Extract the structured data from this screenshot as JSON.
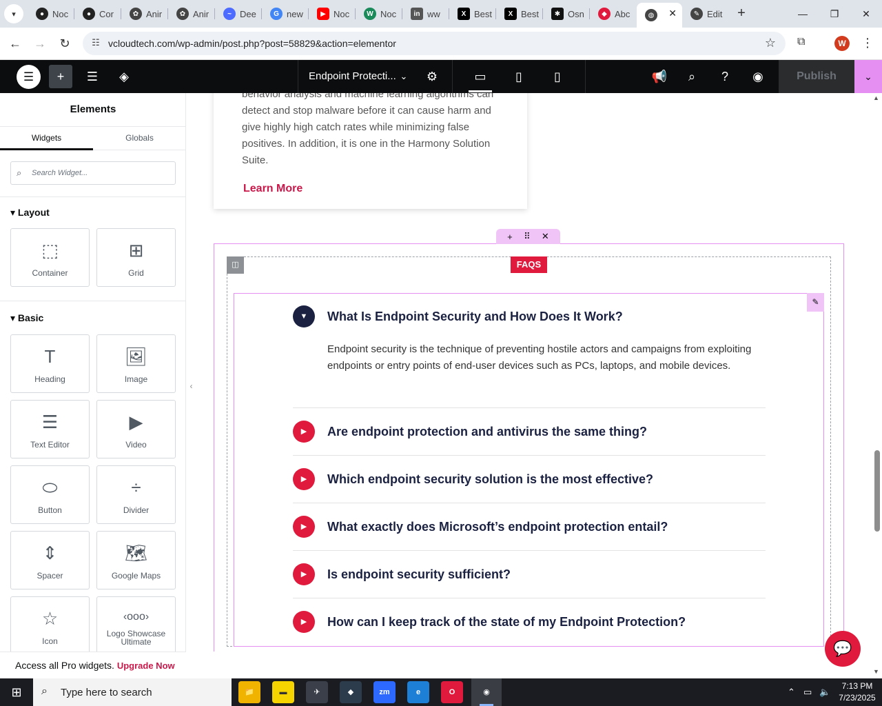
{
  "browser": {
    "tabs": [
      {
        "label": "Noc",
        "icon": "github-icon",
        "color": "#222222"
      },
      {
        "label": "Cor",
        "icon": "github-icon",
        "color": "#222222"
      },
      {
        "label": "Anir",
        "icon": "openai-icon",
        "color": "#444444"
      },
      {
        "label": "Anir",
        "icon": "openai-icon",
        "color": "#444444"
      },
      {
        "label": "Dee",
        "icon": "deepseek-icon",
        "color": "#4d6bfe"
      },
      {
        "label": "new",
        "icon": "google-icon",
        "color": "#4285f4"
      },
      {
        "label": "Noc",
        "icon": "youtube-icon",
        "color": "#ff0000"
      },
      {
        "label": "Noc",
        "icon": "wikipedia-icon",
        "color": "#1a8a5a"
      },
      {
        "label": "ww",
        "icon": "linkedin-icon",
        "color": "#555555"
      },
      {
        "label": "Best",
        "icon": "x-icon",
        "color": "#000000"
      },
      {
        "label": "Best",
        "icon": "x-icon",
        "color": "#000000"
      },
      {
        "label": "Osn",
        "icon": "spark-icon",
        "color": "#111111"
      },
      {
        "label": "Abc",
        "icon": "diamond-icon",
        "color": "#e01a3c"
      },
      {
        "label": "",
        "icon": "globe-icon",
        "color": "#444444"
      },
      {
        "label": "Edit",
        "icon": "edit-icon",
        "color": "#444444"
      }
    ],
    "url": "vcloudtech.com/wp-admin/post.php?post=58829&action=elementor",
    "profile_initial": "W"
  },
  "editor": {
    "page_title": "Endpoint Protecti...",
    "publish_label": "Publish"
  },
  "panel": {
    "title": "Elements",
    "tabs": [
      "Widgets",
      "Globals"
    ],
    "search_placeholder": "Search Widget...",
    "layout_heading": "Layout",
    "basic_heading": "Basic",
    "layout_widgets": [
      "Container",
      "Grid"
    ],
    "basic_widgets": [
      "Heading",
      "Image",
      "Text Editor",
      "Video",
      "Button",
      "Divider",
      "Spacer",
      "Google Maps",
      "Icon",
      "Logo Showcase Ultimate"
    ],
    "upgrade_text": "Access all Pro widgets.",
    "upgrade_link": "Upgrade Now"
  },
  "canvas": {
    "card_text": "behavior analysis and machine learning algorithms can detect and stop malware before it can cause harm and give highly high catch rates while minimizing false positives. In addition, it is one in the Harmony Solution Suite.",
    "card_link": "Learn More",
    "badge": "FAQS",
    "faqs": [
      {
        "question": "What Is Endpoint Security and How Does It Work?",
        "answer": "Endpoint security is the technique of preventing hostile actors and campaigns from exploiting endpoints or entry points of end-user devices such as PCs, laptops, and mobile devices.",
        "open": true
      },
      {
        "question": "Are endpoint protection and antivirus the same thing?",
        "open": false
      },
      {
        "question": "Which endpoint security solution is the most effective?",
        "open": false
      },
      {
        "question": "What exactly does Microsoft’s endpoint protection entail?",
        "open": false
      },
      {
        "question": "Is endpoint security sufficient?",
        "open": false
      },
      {
        "question": "How can I keep track of the state of my Endpoint Protection?",
        "open": false
      }
    ]
  },
  "taskbar": {
    "search_placeholder": "Type here to search",
    "time": "7:13 PM",
    "date": "7/23/2025"
  },
  "colors": {
    "accent_red": "#e01a3c",
    "navy": "#1b2140",
    "elementor_pink": "#e58ff2"
  }
}
